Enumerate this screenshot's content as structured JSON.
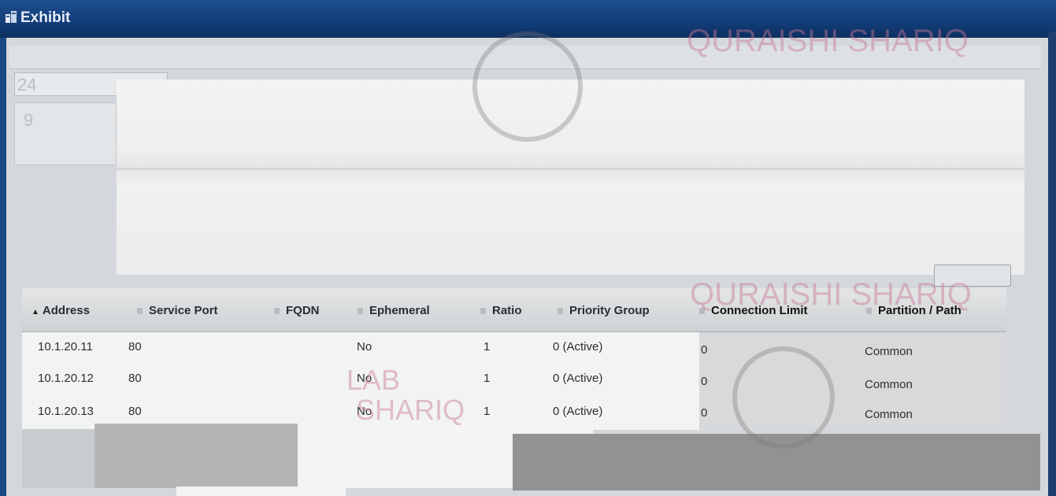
{
  "window": {
    "title": "Exhibit",
    "icon": "exhibit-icon"
  },
  "side": {
    "label_1": "24",
    "label_2": "9"
  },
  "table": {
    "columns": [
      {
        "key": "address",
        "label": "Address",
        "sorted": true
      },
      {
        "key": "service_port",
        "label": "Service Port"
      },
      {
        "key": "fqdn",
        "label": "FQDN"
      },
      {
        "key": "ephemeral",
        "label": "Ephemeral"
      },
      {
        "key": "ratio",
        "label": "Ratio"
      },
      {
        "key": "priority_group",
        "label": "Priority Group"
      },
      {
        "key": "connection_limit",
        "label": "Connection Limit"
      },
      {
        "key": "partition_path",
        "label": "Partition / Path"
      }
    ],
    "rows": [
      {
        "address": "10.1.20.11",
        "service_port": "80",
        "fqdn": "",
        "ephemeral": "No",
        "ratio": "1",
        "priority_group": "0 (Active)",
        "connection_limit": "0",
        "partition_path": "Common"
      },
      {
        "address": "10.1.20.12",
        "service_port": "80",
        "fqdn": "",
        "ephemeral": "No",
        "ratio": "1",
        "priority_group": "0 (Active)",
        "connection_limit": "0",
        "partition_path": "Common"
      },
      {
        "address": "10.1.20.13",
        "service_port": "80",
        "fqdn": "",
        "ephemeral": "No",
        "ratio": "1",
        "priority_group": "0 (Active)",
        "connection_limit": "0",
        "partition_path": "Common"
      }
    ]
  },
  "watermarks": {
    "name": "QURAISHI SHARIQ",
    "lab": "LAB",
    "shariq": "SHARIQ"
  },
  "colors": {
    "titlebar": "#123d78",
    "header": "#cfd2d4"
  }
}
